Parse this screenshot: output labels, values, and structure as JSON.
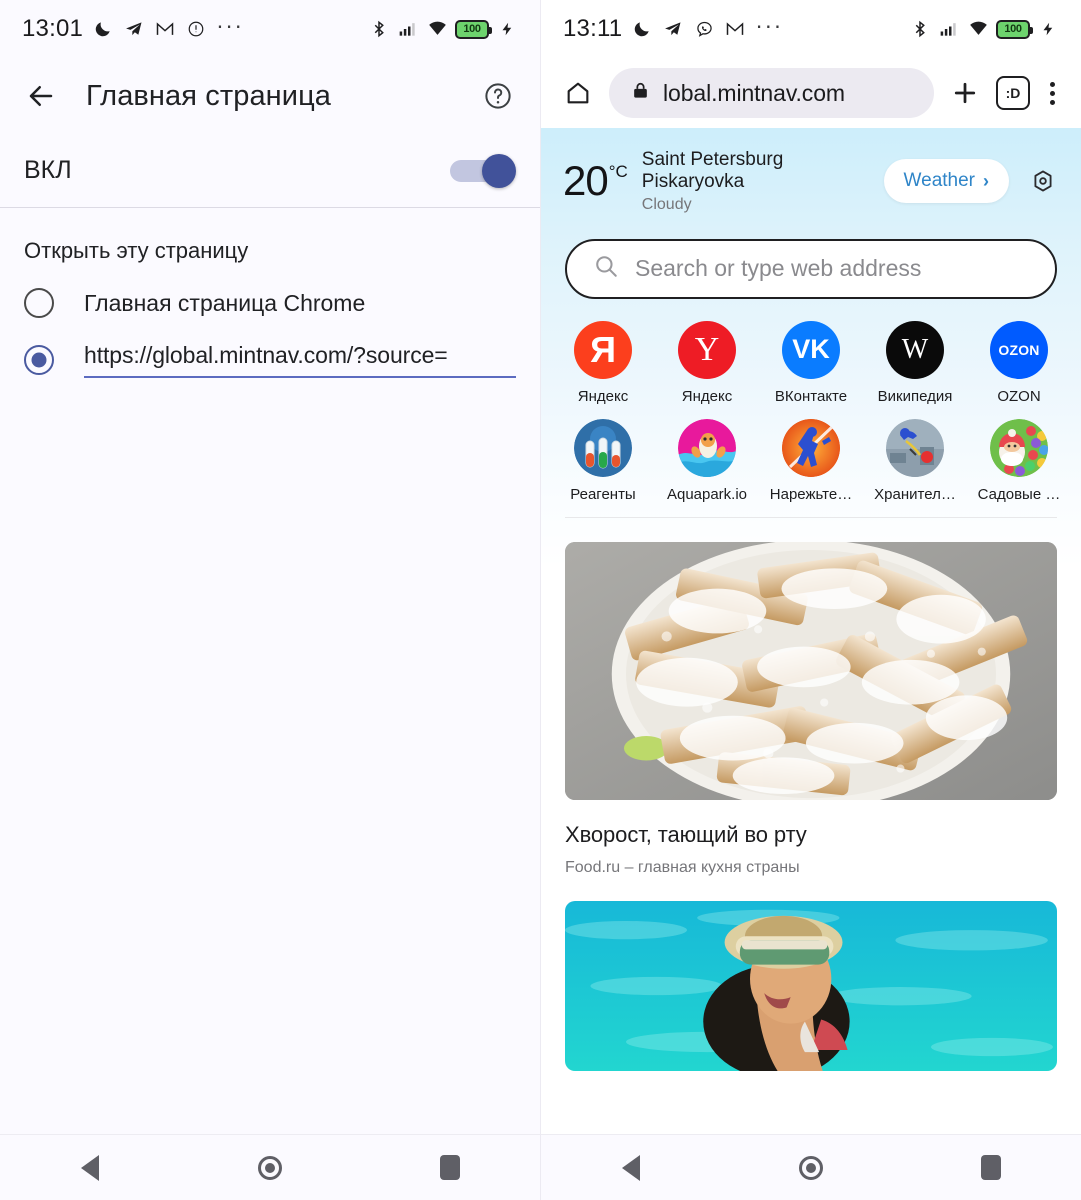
{
  "left_panel": {
    "statusbar": {
      "time": "13:01",
      "icons": [
        "moon-icon",
        "telegram-icon",
        "gmail-icon",
        "pocket-icon",
        "more-dots-icon"
      ],
      "right_icons": [
        "bluetooth-icon",
        "signal-icon",
        "wifi-icon"
      ],
      "battery": "100",
      "charging": true
    },
    "header": {
      "back": "back-arrow-icon",
      "title": "Главная страница",
      "help": "help-circle-icon"
    },
    "toggle": {
      "label": "ВКЛ",
      "on": true
    },
    "section_label": "Открыть эту страницу",
    "options": [
      {
        "label": "Главная страница Chrome",
        "selected": false,
        "type": "radio"
      },
      {
        "label": "https://global.mintnav.com/?source=",
        "selected": true,
        "type": "url"
      }
    ]
  },
  "right_panel": {
    "statusbar": {
      "time": "13:11",
      "icons": [
        "moon-icon",
        "telegram-icon",
        "viber-icon",
        "gmail-icon",
        "more-dots-icon"
      ],
      "right_icons": [
        "bluetooth-icon",
        "signal-icon",
        "wifi-icon"
      ],
      "battery": "100",
      "charging": true
    },
    "toolbar": {
      "home": "home-icon",
      "lock": "lock-icon",
      "url": "lobal.mintnav.com",
      "new_tab": "plus-icon",
      "tab_count": ":D",
      "menu": "kebab-menu-icon"
    },
    "weather": {
      "temperature": "20",
      "unit": "°C",
      "city": "Saint Petersburg",
      "district": "Piskaryovka",
      "condition": "Cloudy",
      "button_label": "Weather",
      "button_chevron": "›",
      "gear": "settings-gear-icon"
    },
    "search": {
      "placeholder": "Search or type web address",
      "icon": "search-icon"
    },
    "shortcuts_row1": [
      {
        "label": "Яндекс",
        "glyph": "Я",
        "style": "ic-yandex-ru",
        "icon_name": "yandex-ru-icon"
      },
      {
        "label": "Яндекс",
        "glyph": "Y",
        "style": "ic-yandex-y",
        "icon_name": "yandex-y-icon"
      },
      {
        "label": "ВКонтакте",
        "glyph": "VK",
        "style": "ic-vk",
        "icon_name": "vkontakte-icon"
      },
      {
        "label": "Википедия",
        "glyph": "W",
        "style": "ic-wiki",
        "icon_name": "wikipedia-icon"
      },
      {
        "label": "OZON",
        "glyph": "OZON",
        "style": "ic-ozon",
        "icon_name": "ozon-icon"
      }
    ],
    "shortcuts_row2": [
      {
        "label": "Реагенты",
        "icon_name": "reagents-game-icon"
      },
      {
        "label": "Aquapark.io",
        "icon_name": "aquapark-game-icon"
      },
      {
        "label": "Нарежьте…",
        "icon_name": "slice-game-icon"
      },
      {
        "label": "Хранител…",
        "icon_name": "guardian-game-icon"
      },
      {
        "label": "Садовые …",
        "icon_name": "garden-game-icon"
      }
    ],
    "feed": [
      {
        "title": "Хворост, тающий во рту",
        "source": "Food.ru – главная кухня страны",
        "image_name": "fried-pastry-photo"
      },
      {
        "title": "",
        "source": "",
        "image_name": "woman-in-turquoise-sea-photo"
      }
    ]
  },
  "navbar": {
    "back": "back-triangle-icon",
    "home": "home-circle-icon",
    "recents": "recents-square-icon"
  },
  "colors": {
    "accent_toggle": "#41529a",
    "radio_selected": "#4a5aa0",
    "weather_link": "#2f85c8",
    "hero_top": "#cdeefb",
    "battery_green": "#6dd36d"
  }
}
